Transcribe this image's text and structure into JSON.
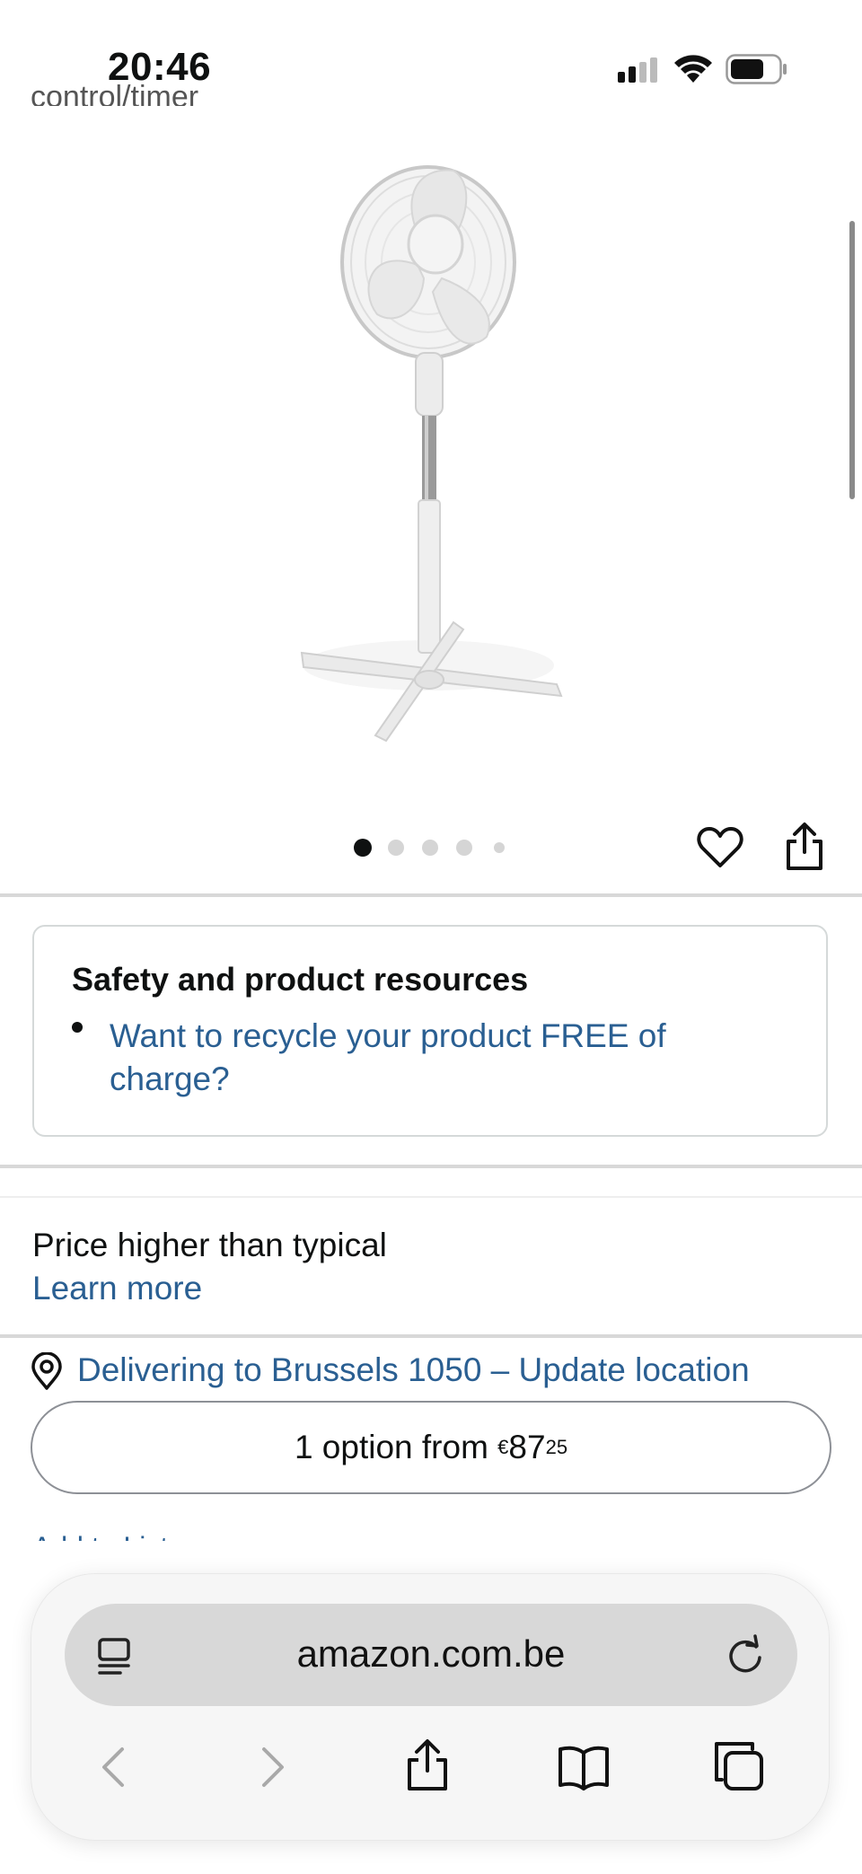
{
  "status_bar": {
    "time": "20:46"
  },
  "scrolled_text": "control/timer",
  "carousel": {
    "total_images": 5,
    "active_index": 1
  },
  "safety_card": {
    "title": "Safety and product resources",
    "link": "Want to recycle your product FREE of charge?"
  },
  "price_note": {
    "text": "Price higher than typical",
    "link": "Learn more"
  },
  "delivery": {
    "text": "Delivering to Brussels 1050 – Update location"
  },
  "option_button": {
    "prefix": "1 option from ",
    "currency": "€",
    "whole": "87",
    "fraction": "25"
  },
  "cut_text": "Add to List",
  "browser": {
    "url": "amazon.com.be"
  },
  "colors": {
    "link": "#2a5f92",
    "text": "#0f1111",
    "divider": "#d8d8d8"
  }
}
